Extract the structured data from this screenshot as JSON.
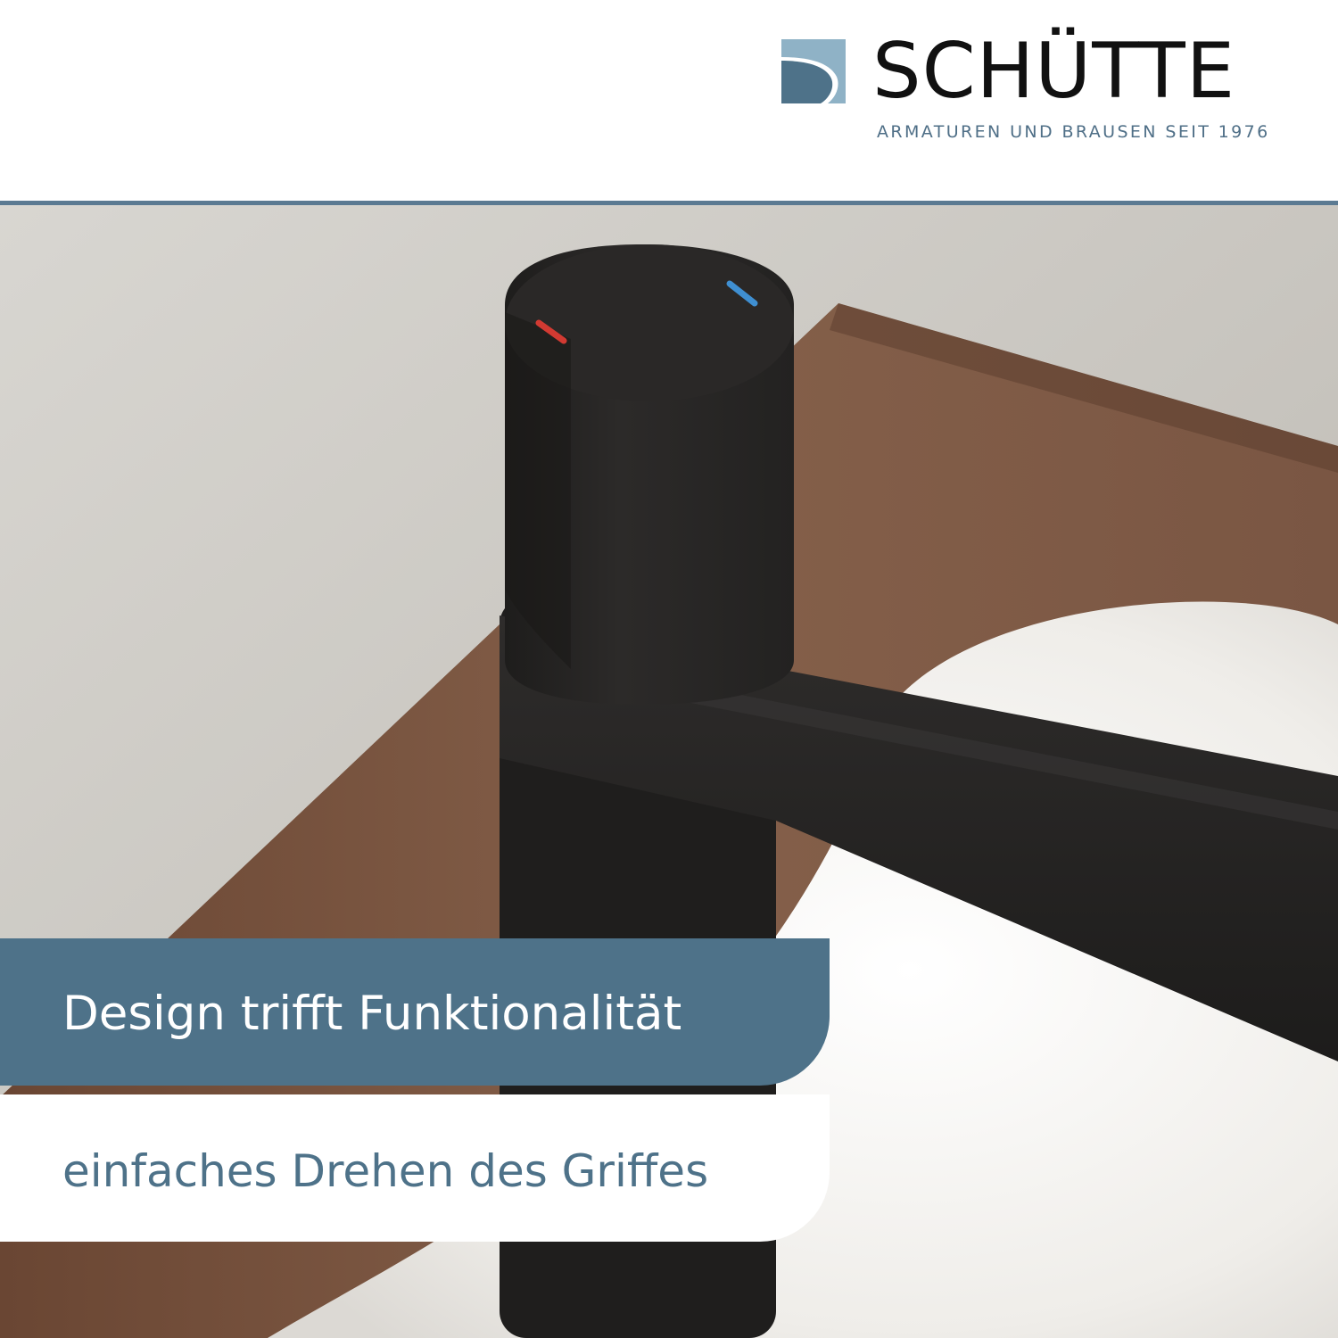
{
  "brand": {
    "name": "SCHÜTTE",
    "tagline": "ARMATUREN UND BRAUSEN SEIT 1976",
    "logo_icon": "s-wave-logo-icon",
    "colors": {
      "logo_light": "#8fb2c6",
      "logo_dark": "#4e7289",
      "name": "#111111",
      "tagline": "#4f6f87",
      "rule": "#5b7a92"
    }
  },
  "photo": {
    "subject": "faucet-photo",
    "colors": {
      "wall": "#cdcbc6",
      "wood": "#7a5540",
      "basin": "#f2f0ec",
      "faucet": "#262423",
      "hot_marker": "#d23a32",
      "cold_marker": "#3f8fd1"
    }
  },
  "banners": {
    "primary_text": "Design trifft Funktionalität",
    "secondary_text": "einfaches Drehen des Griffes",
    "colors": {
      "primary_bg": "#4e7289",
      "primary_text": "#ffffff",
      "secondary_bg": "#ffffff",
      "secondary_text": "#4e7289"
    }
  }
}
